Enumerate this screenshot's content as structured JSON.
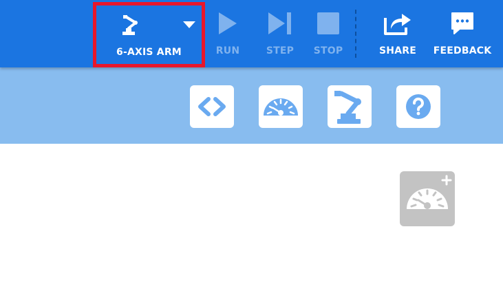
{
  "toolbar": {
    "device_selector": {
      "label": "6-AXIS ARM",
      "icon": "robot-arm-icon"
    },
    "run_label": "RUN",
    "step_label": "STEP",
    "stop_label": "STOP",
    "share_label": "SHARE",
    "feedback_label": "FEEDBACK"
  },
  "secondary_toolbar": {
    "tiles": [
      {
        "icon": "code-icon"
      },
      {
        "icon": "dashboard-icon"
      },
      {
        "icon": "robot-arm-icon"
      },
      {
        "icon": "help-icon"
      }
    ]
  },
  "workspace": {
    "add_widget_icon": "add-dashboard-icon"
  },
  "colors": {
    "primary": "#1b75e1",
    "secondary_bar": "#88bcef",
    "highlight_border": "#e8162b",
    "disabled_text": "#7fb2ee",
    "tile_icon": "#6aaaf0",
    "add_widget_bg": "#c3c3c3"
  }
}
